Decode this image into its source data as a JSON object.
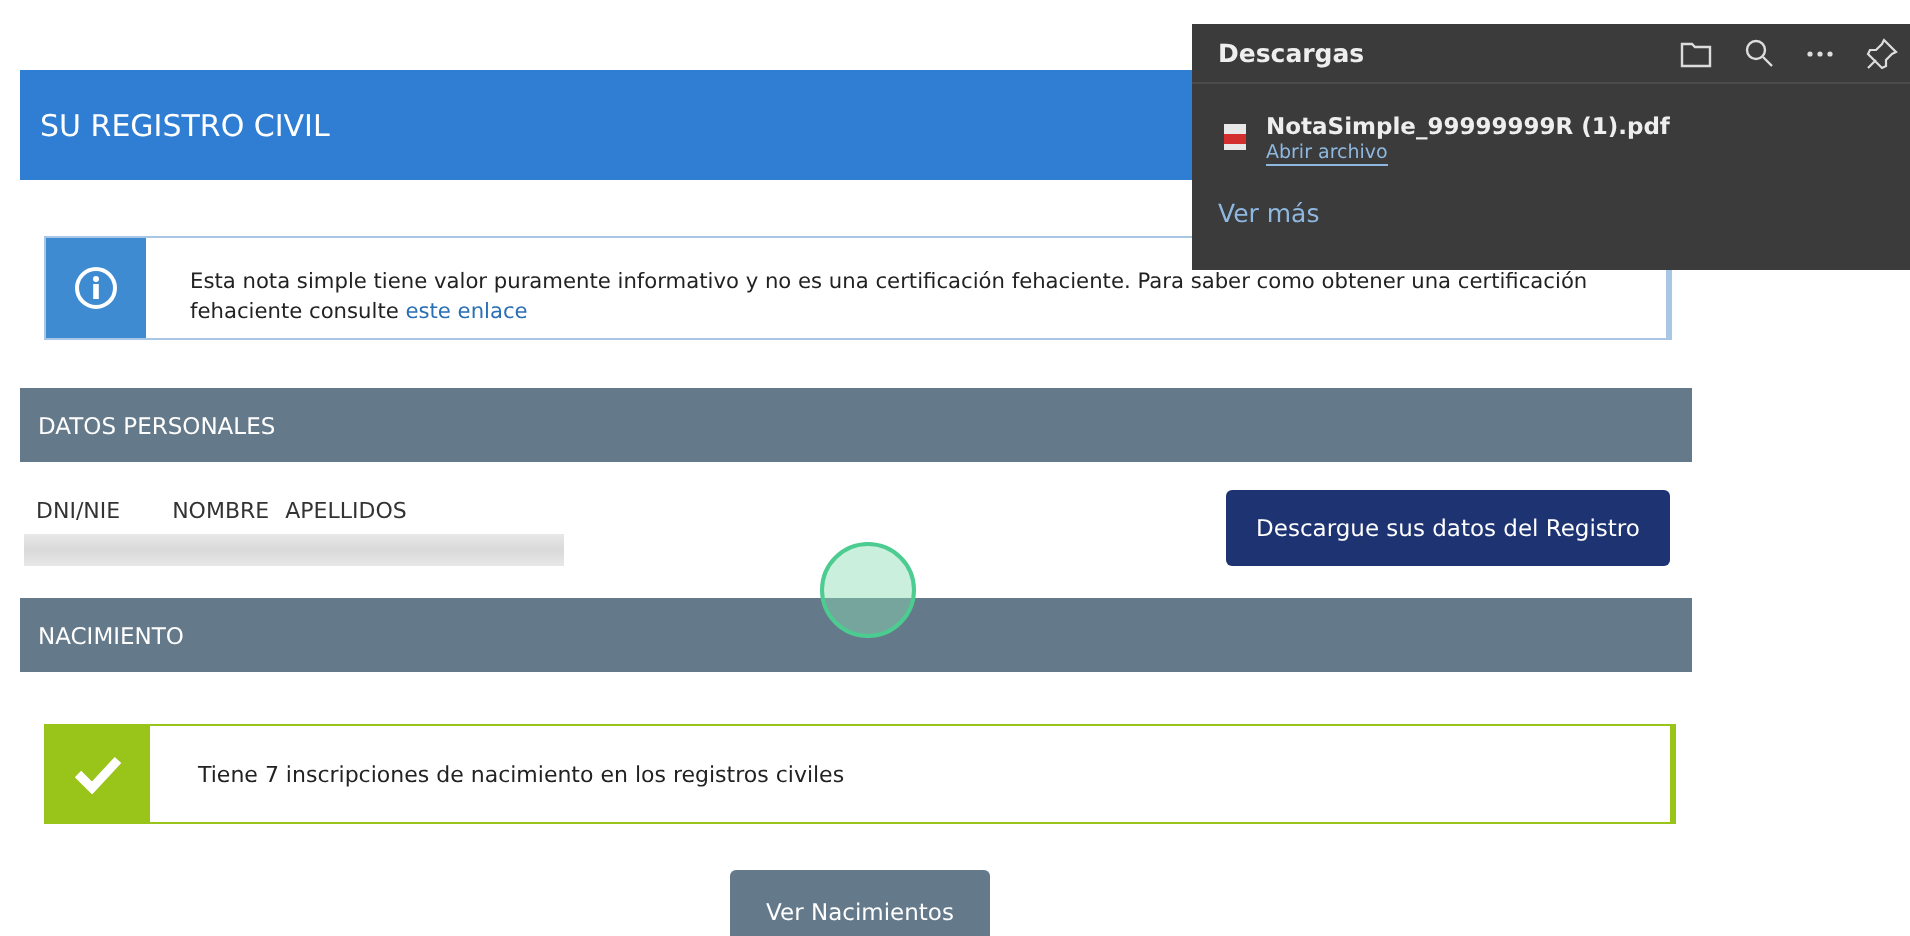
{
  "header": {
    "title": "SU REGISTRO CIVIL"
  },
  "info_notice": {
    "text": "Esta nota simple tiene valor puramente informativo y no es una certificación fehaciente. Para saber como obtener una certificación fehaciente consulte ",
    "link": "este enlace"
  },
  "sections": [
    {
      "title": "DATOS PERSONALES",
      "kind": "personal",
      "columns": [
        "DNI/NIE",
        "NOMBRE",
        "APELLIDOS"
      ],
      "button": "Descargue sus datos del Registro"
    },
    {
      "title": "NACIMIENTO",
      "kind": "births",
      "message": "Tiene 7 inscripciones de nacimiento en los registros civiles",
      "button": "Ver Nacimientos"
    }
  ],
  "downloads_panel": {
    "title": "Descargas",
    "files": [
      {
        "name": "NotaSimple_99999999R (1).pdf",
        "action": "Abrir archivo"
      }
    ],
    "more": "Ver más"
  }
}
